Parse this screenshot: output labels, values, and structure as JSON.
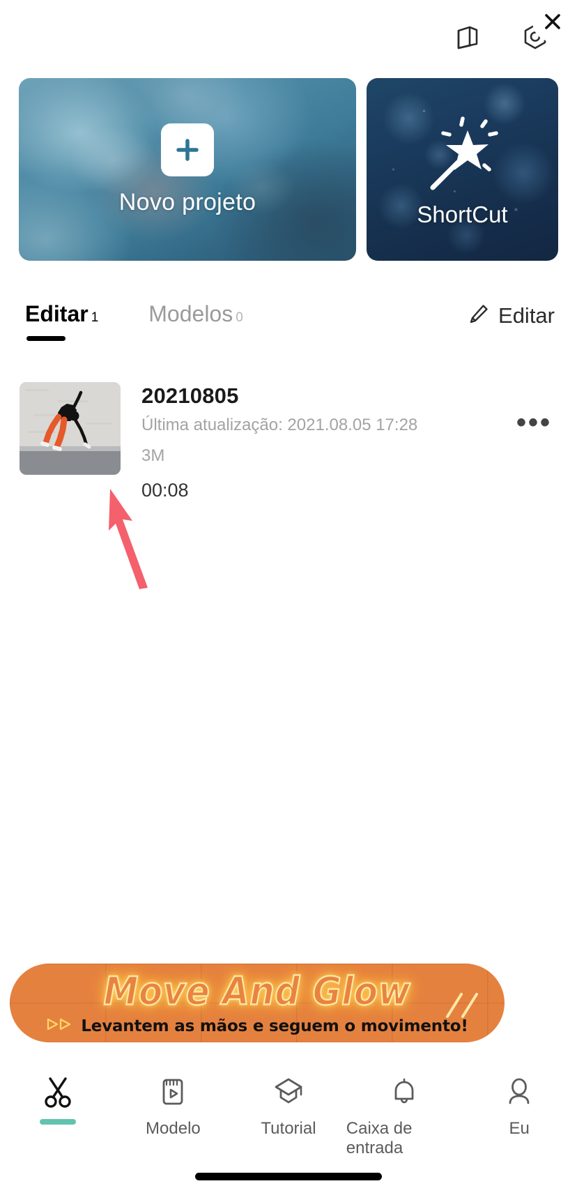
{
  "header": {
    "book_icon": "book-icon",
    "settings_icon": "hex-settings-icon"
  },
  "cards": {
    "new_project": {
      "label": "Novo projeto",
      "icon": "plus-icon"
    },
    "shortcut": {
      "label": "ShortCut",
      "icon": "magic-wand-icon"
    }
  },
  "tabs": {
    "items": [
      {
        "label": "Editar",
        "count": "1",
        "active": true
      },
      {
        "label": "Modelos",
        "count": "0",
        "active": false
      }
    ],
    "edit_action": {
      "label": "Editar",
      "icon": "pencil-icon"
    }
  },
  "projects": [
    {
      "title": "20210805",
      "updated": "Última atualização: 2021.08.05 17:28",
      "size": "3M",
      "duration": "00:08",
      "more_icon": "more-dots-icon",
      "more_label": "•••"
    }
  ],
  "annotation": {
    "arrow_color": "#f4606c",
    "icon": "up-left-arrow-annotation"
  },
  "ad": {
    "title": "Move And Glow",
    "subtitle": "Levantem as mãos e seguem o movimento!",
    "close_icon": "close-x-icon",
    "play_icon": "double-triangle-icon",
    "bg_color": "#e5813f",
    "glow_color": "#ffd766"
  },
  "bottom_nav": {
    "items": [
      {
        "label": "",
        "icon": "scissors-icon",
        "active": true
      },
      {
        "label": "Modelo",
        "icon": "template-video-icon",
        "active": false
      },
      {
        "label": "Tutorial",
        "icon": "graduation-cap-icon",
        "active": false
      },
      {
        "label": "Caixa de entrada",
        "icon": "bell-icon",
        "active": false
      },
      {
        "label": "Eu",
        "icon": "person-icon",
        "active": false
      }
    ],
    "active_indicator_color": "#62c3ae"
  }
}
